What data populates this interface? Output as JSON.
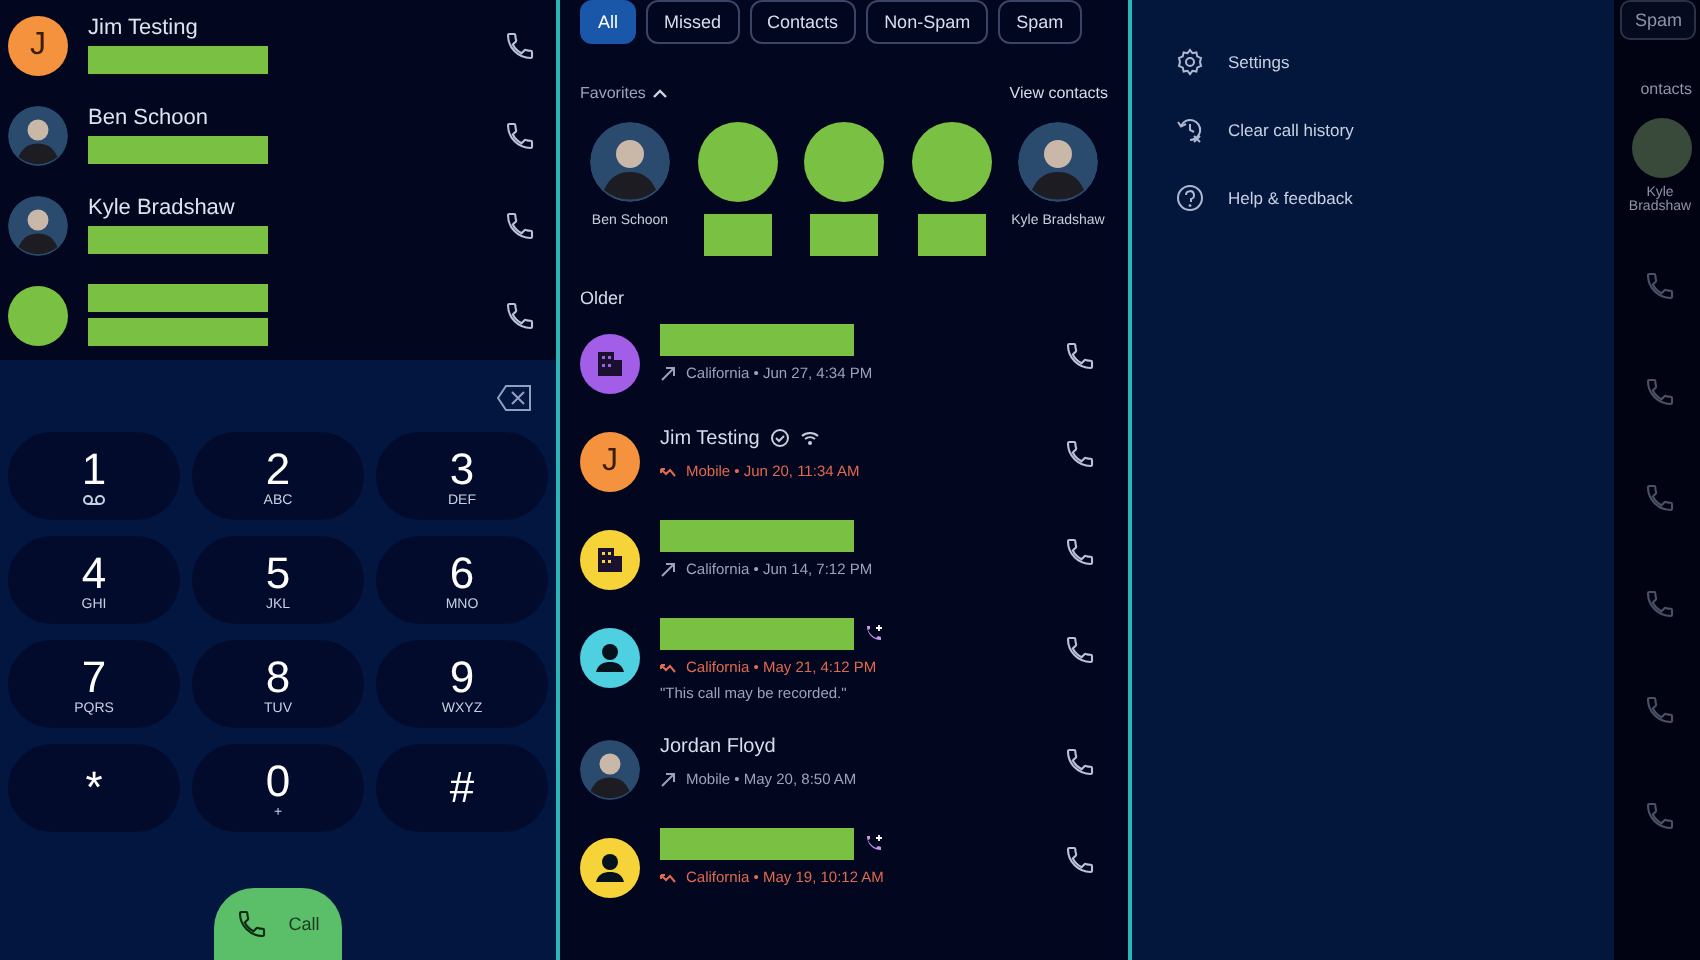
{
  "contacts": [
    {
      "name": "Jim Testing",
      "kind": "letter",
      "initial": "J",
      "color": "#f5923e"
    },
    {
      "name": "Ben Schoon",
      "kind": "photo"
    },
    {
      "name": "Kyle Bradshaw",
      "kind": "photo"
    },
    {
      "kind": "blank"
    }
  ],
  "dialpad": {
    "keys": [
      {
        "digit": "1",
        "kind": "voicemail"
      },
      {
        "digit": "2",
        "letters": "ABC",
        "kind": "letters"
      },
      {
        "digit": "3",
        "letters": "DEF",
        "kind": "letters"
      },
      {
        "digit": "4",
        "letters": "GHI",
        "kind": "letters"
      },
      {
        "digit": "5",
        "letters": "JKL",
        "kind": "letters"
      },
      {
        "digit": "6",
        "letters": "MNO",
        "kind": "letters"
      },
      {
        "digit": "7",
        "letters": "PQRS",
        "kind": "letters"
      },
      {
        "digit": "8",
        "letters": "TUV",
        "kind": "letters"
      },
      {
        "digit": "9",
        "letters": "WXYZ",
        "kind": "letters"
      },
      {
        "digit": "*",
        "kind": "symbol"
      },
      {
        "digit": "0",
        "letters": "+",
        "kind": "letters"
      },
      {
        "digit": "#",
        "kind": "symbol"
      }
    ],
    "call_button": "Call"
  },
  "filters": [
    {
      "label": "All",
      "selected": true
    },
    {
      "label": "Missed",
      "selected": false
    },
    {
      "label": "Contacts",
      "selected": false
    },
    {
      "label": "Non-Spam",
      "selected": false
    },
    {
      "label": "Spam",
      "selected": false
    }
  ],
  "favorites": {
    "heading": "Favorites",
    "link": "View contacts",
    "items": [
      {
        "name": "Ben Schoon",
        "kind": "photo"
      },
      {
        "kind": "blank"
      },
      {
        "kind": "blank"
      },
      {
        "kind": "blank"
      },
      {
        "name": "Kyle Bradshaw",
        "kind": "photo"
      }
    ]
  },
  "section": "Older",
  "calls": [
    {
      "kind": "business",
      "color": "#a35ee8",
      "missed": false,
      "detail": "California • Jun 27, 4:34 PM"
    },
    {
      "name": "Jim Testing",
      "kind": "letter",
      "initial": "J",
      "color": "#f5923e",
      "missed": true,
      "detail": "Mobile • Jun 20, 11:34 AM",
      "badges": [
        {
          "kind": "verified"
        },
        {
          "kind": "wifi"
        }
      ]
    },
    {
      "kind": "business",
      "color": "#f7d33a",
      "missed": false,
      "detail": "California • Jun 14, 7:12 PM"
    },
    {
      "kind": "person",
      "color": "#4fd0e0",
      "missed": true,
      "detail": "California • May 21, 4:12 PM",
      "badges": [
        {
          "kind": "call-add"
        }
      ],
      "note": "\"This call may be recorded.\""
    },
    {
      "name": "Jordan Floyd",
      "kind": "photo",
      "missed": false,
      "detail": "Mobile • May 20, 8:50 AM"
    },
    {
      "kind": "person",
      "color": "#f7d33a",
      "missed": true,
      "detail": "California • May 19, 10:12 AM",
      "badges": [
        {
          "kind": "call-add"
        }
      ]
    }
  ],
  "menu": {
    "items": [
      {
        "label": "Settings",
        "kind": "gear"
      },
      {
        "label": "Clear call history",
        "kind": "clear-history"
      },
      {
        "label": "Help & feedback",
        "kind": "help"
      }
    ]
  },
  "dimmed_strip": {
    "chip": "Spam",
    "link": "ontacts",
    "name": "Kyle Bradshaw"
  }
}
